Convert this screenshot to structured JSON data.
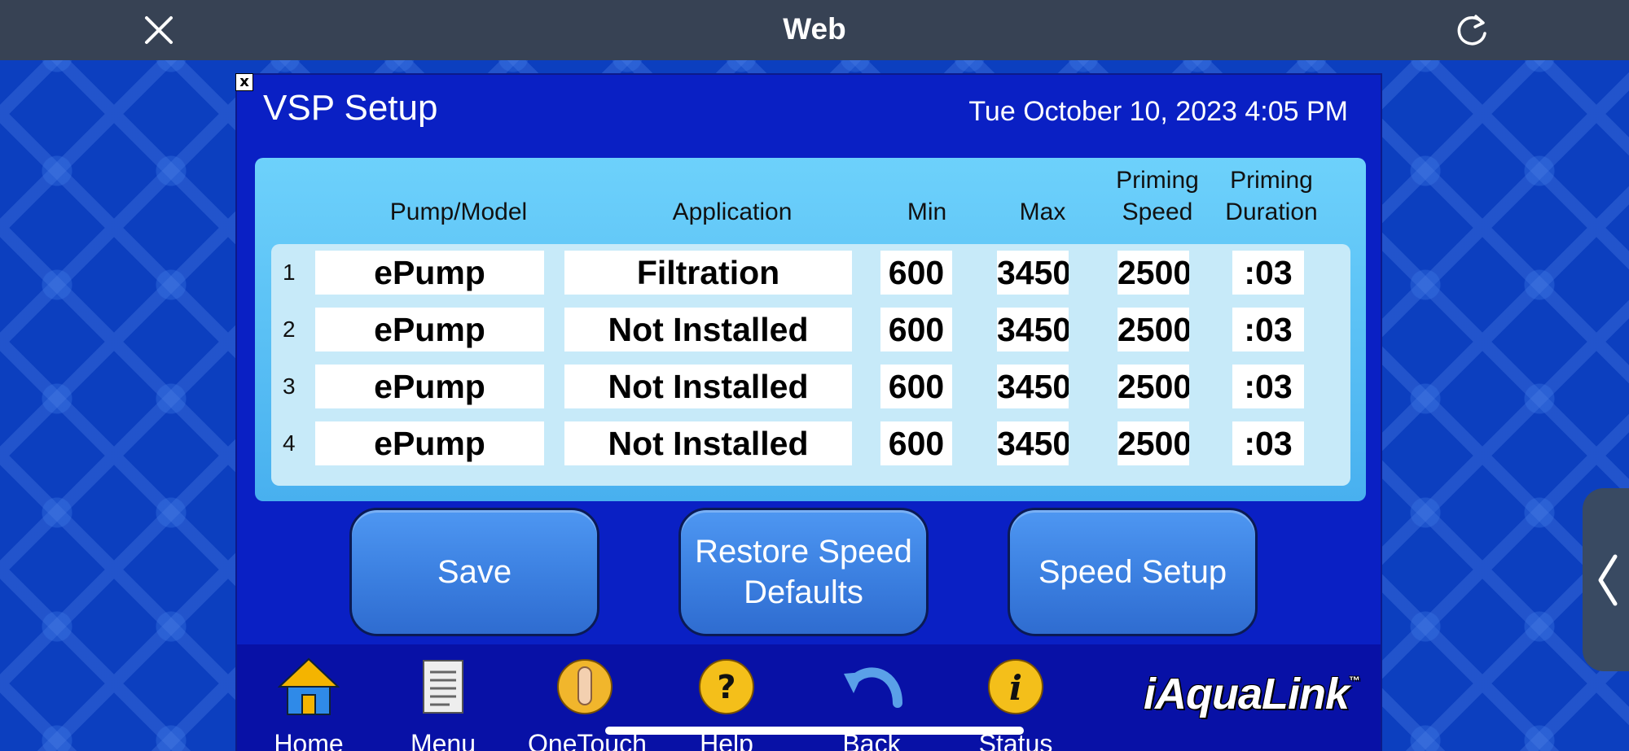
{
  "nav": {
    "title": "Web",
    "close_icon": "close-icon",
    "reload_icon": "reload-icon"
  },
  "panel": {
    "close_label": "x",
    "title": "VSP Setup",
    "datetime": "Tue October 10, 2023 4:05 PM"
  },
  "table": {
    "headers": {
      "pump_model": "Pump/Model",
      "application": "Application",
      "min": "Min",
      "max": "Max",
      "priming_speed": "Priming\nSpeed",
      "priming_duration": "Priming\nDuration"
    },
    "rows": [
      {
        "num": "1",
        "pump": "ePump",
        "application": "Filtration",
        "min": "600",
        "max": "3450",
        "priming_speed": "2500",
        "priming_duration": ":03"
      },
      {
        "num": "2",
        "pump": "ePump",
        "application": "Not Installed",
        "min": "600",
        "max": "3450",
        "priming_speed": "2500",
        "priming_duration": ":03"
      },
      {
        "num": "3",
        "pump": "ePump",
        "application": "Not Installed",
        "min": "600",
        "max": "3450",
        "priming_speed": "2500",
        "priming_duration": ":03"
      },
      {
        "num": "4",
        "pump": "ePump",
        "application": "Not Installed",
        "min": "600",
        "max": "3450",
        "priming_speed": "2500",
        "priming_duration": ":03"
      }
    ]
  },
  "buttons": {
    "save": "Save",
    "restore": "Restore Speed\nDefaults",
    "speed_setup": "Speed Setup"
  },
  "toolbar": {
    "items": [
      {
        "label": "Home",
        "icon": "home-icon"
      },
      {
        "label": "Menu",
        "icon": "menu-icon"
      },
      {
        "label": "OneTouch",
        "icon": "onetouch-icon"
      },
      {
        "label": "Help",
        "icon": "help-icon"
      },
      {
        "label": "Back",
        "icon": "back-icon"
      },
      {
        "label": "Status",
        "icon": "status-icon"
      }
    ],
    "brand": "iAquaLink",
    "brand_mark": "™"
  },
  "colors": {
    "background": "#0c3fbf",
    "panel": "#0a20c4",
    "table_card": "#5ec4f7",
    "rows_box": "#c7eaf9",
    "button": "#3b7fe0",
    "navbar": "#374254"
  }
}
